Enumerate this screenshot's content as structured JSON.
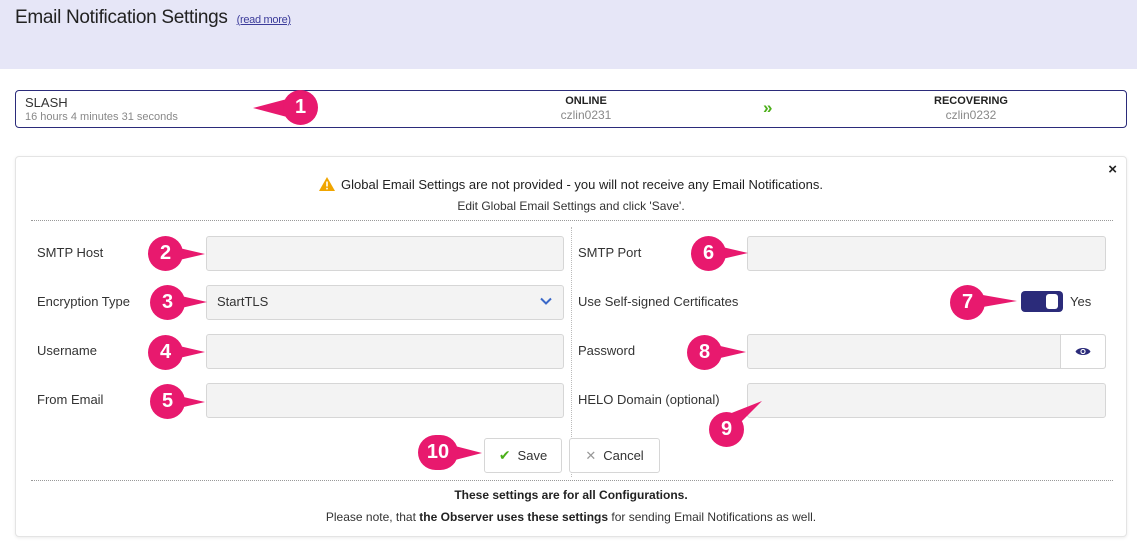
{
  "page": {
    "title": "Email Notification Settings",
    "read_more": "(read more)"
  },
  "status": {
    "cluster_name": "SLASH",
    "uptime": "16 hours 4 minutes 31 seconds",
    "node_a": {
      "state": "ONLINE",
      "host": "czlin0231"
    },
    "node_b": {
      "state": "RECOVERING",
      "host": "czlin0232"
    },
    "arrow_icon": "double-chevron-right-icon"
  },
  "panel": {
    "warning": "Global Email Settings are not provided - you will not receive any Email Notifications.",
    "hint": "Edit Global Email Settings and click 'Save'.",
    "close": "×",
    "fields": {
      "smtp_host": {
        "label": "SMTP Host",
        "value": ""
      },
      "smtp_port": {
        "label": "SMTP Port",
        "value": ""
      },
      "encryption_type": {
        "label": "Encryption Type",
        "value": "StartTLS"
      },
      "self_signed": {
        "label": "Use Self-signed Certificates",
        "value": "Yes"
      },
      "username": {
        "label": "Username",
        "value": ""
      },
      "password": {
        "label": "Password",
        "value": ""
      },
      "from_email": {
        "label": "From Email",
        "value": ""
      },
      "helo_domain": {
        "label": "HELO Domain (optional)",
        "value": ""
      }
    },
    "buttons": {
      "save": "Save",
      "cancel": "Cancel"
    },
    "footer_line1": "These settings are for all Configurations.",
    "footer_line2_pre": "Please note, that ",
    "footer_line2_bold": "the Observer uses these settings",
    "footer_line2_post": " for sending Email Notifications as well."
  },
  "callouts": [
    "1",
    "2",
    "3",
    "4",
    "5",
    "6",
    "7",
    "8",
    "9",
    "10"
  ],
  "colors": {
    "accent": "#2b2b7a",
    "callout": "#e8196e",
    "success": "#4caf1a",
    "warning": "#f0a500",
    "header_bg": "#e6e6f7"
  }
}
